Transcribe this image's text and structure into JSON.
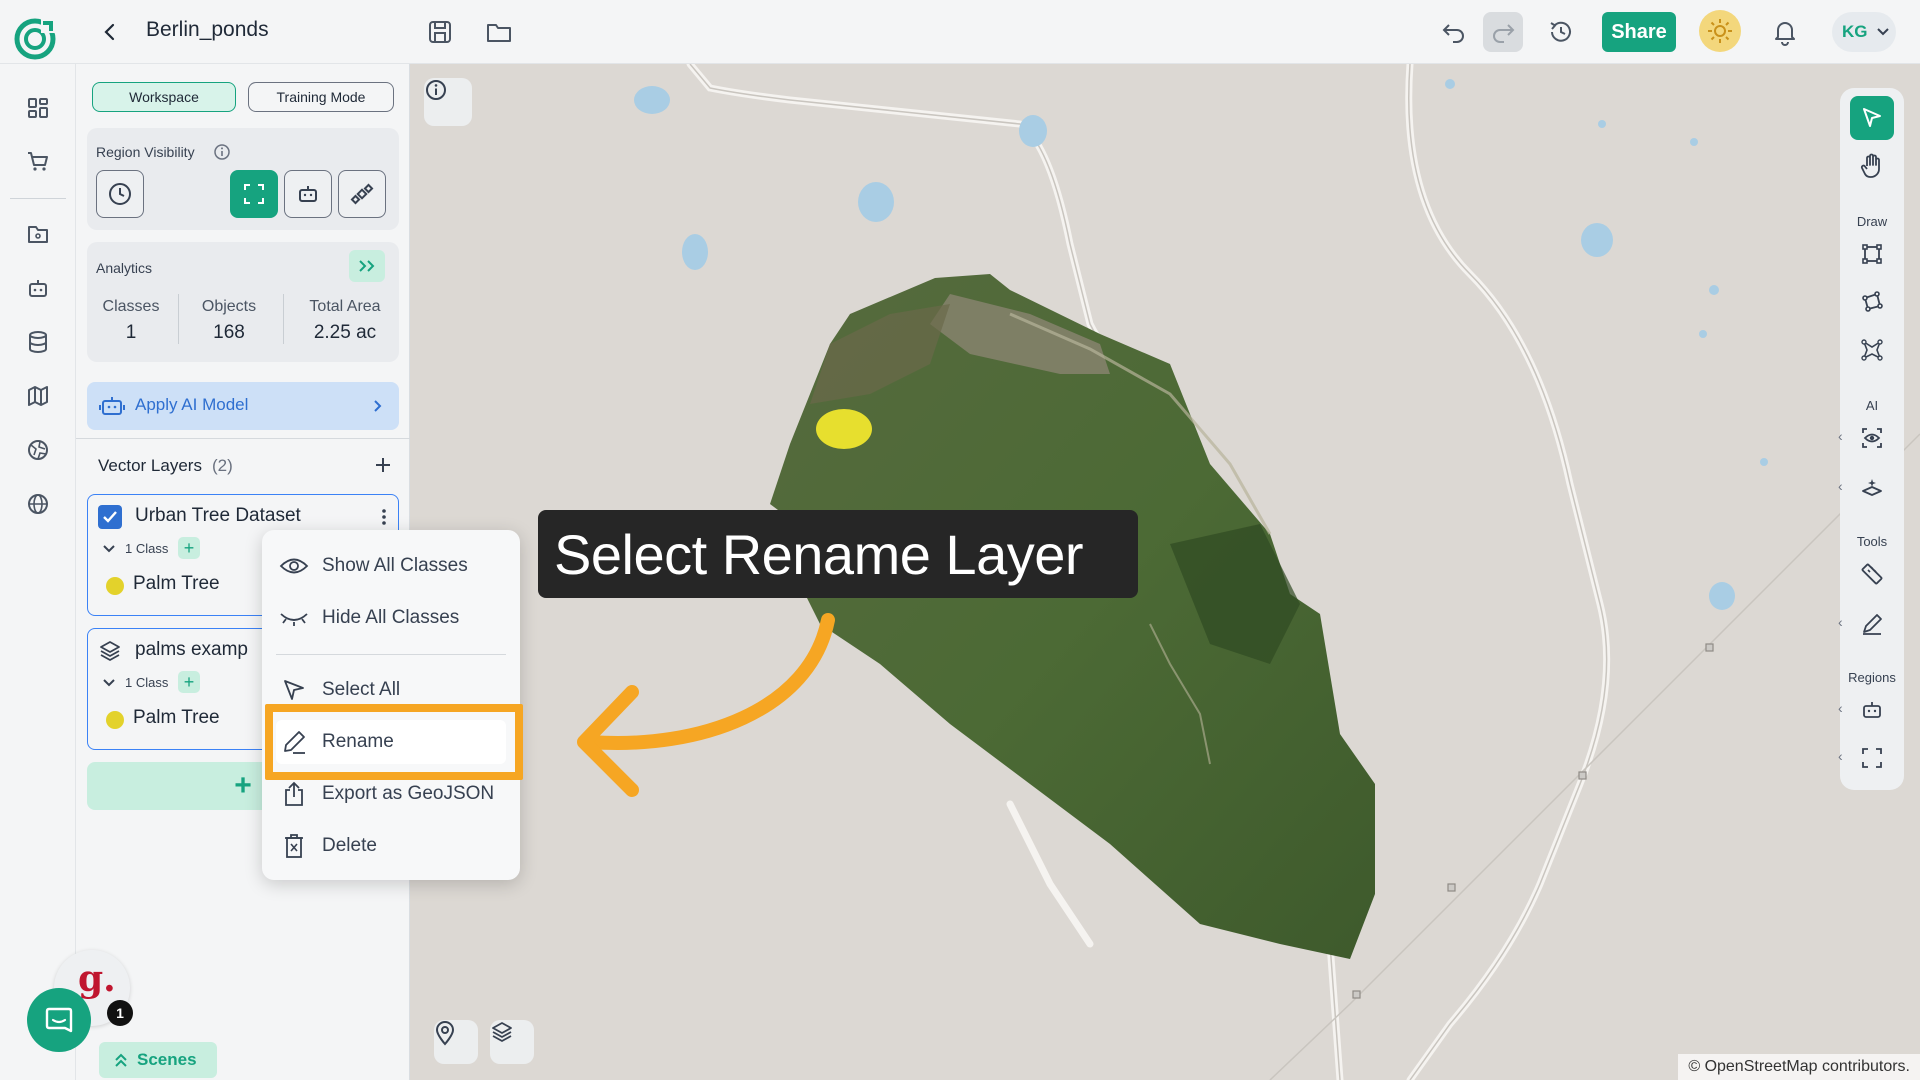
{
  "header": {
    "title": "Berlin_ponds",
    "share_label": "Share",
    "user_initials": "KG",
    "icons": [
      "back-icon",
      "save-icon",
      "folder-icon",
      "undo-icon",
      "redo-icon",
      "history-icon",
      "theme-icon",
      "bell-icon",
      "chevron-down-icon"
    ]
  },
  "left_rail": {
    "icons": [
      "dashboard-icon",
      "cart-icon",
      "folder-map-icon",
      "robot-icon",
      "database-icon",
      "map-icon",
      "globe-grid-icon",
      "globe-icon"
    ]
  },
  "panel": {
    "tabs": [
      {
        "label": "Workspace",
        "active": true
      },
      {
        "label": "Training Mode",
        "active": false
      }
    ],
    "region_visibility": {
      "title": "Region Visibility"
    },
    "analytics": {
      "title": "Analytics",
      "stats": [
        {
          "label": "Classes",
          "value": "1"
        },
        {
          "label": "Objects",
          "value": "168"
        },
        {
          "label": "Total Area",
          "value": "2.25 ac"
        }
      ]
    },
    "apply_ai_label": "Apply AI Model",
    "vector_layers": {
      "title": "Vector Layers",
      "count": "(2)",
      "layers": [
        {
          "name": "Urban Tree Dataset",
          "class_count": "1 Class",
          "class_name": "Palm Tree"
        },
        {
          "name": "palms examp",
          "class_count": "1 Class",
          "class_name": "Palm Tree"
        }
      ]
    },
    "add_layer_label": "+"
  },
  "context_menu": {
    "items": [
      {
        "label": "Show All Classes",
        "icon": "eye-icon"
      },
      {
        "label": "Hide All Classes",
        "icon": "eye-closed-icon"
      },
      {
        "label": "Select All",
        "icon": "cursor-icon"
      },
      {
        "label": "Rename",
        "icon": "pencil-icon"
      },
      {
        "label": "Export as GeoJSON",
        "icon": "export-icon"
      },
      {
        "label": "Delete",
        "icon": "trash-icon"
      }
    ]
  },
  "annotation": {
    "text": "Select Rename Layer"
  },
  "right_toolbar": {
    "sections": {
      "draw": "Draw",
      "ai": "AI",
      "tools": "Tools",
      "regions": "Regions"
    }
  },
  "map": {
    "attribution": "© OpenStreetMap contributors."
  },
  "chat": {
    "count": "1",
    "scenes_label": "Scenes",
    "brand_letter": "g."
  },
  "colors": {
    "accent": "#16a37f",
    "highlight": "#f6a623",
    "link": "#2f6fd0"
  }
}
